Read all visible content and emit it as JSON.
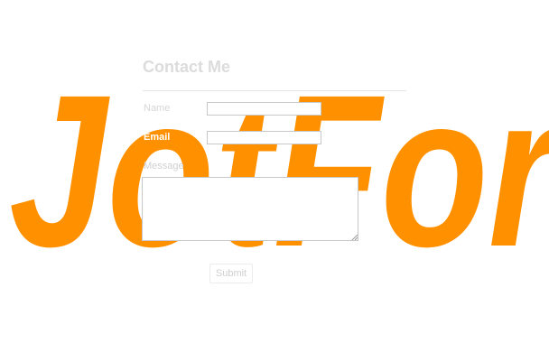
{
  "watermark": {
    "text": "JotForm",
    "color": "#ff9100"
  },
  "form": {
    "title": "Contact Me",
    "fields": {
      "name": {
        "label": "Name",
        "value": ""
      },
      "email": {
        "label": "Email",
        "value": ""
      },
      "message": {
        "label": "Message",
        "value": ""
      }
    },
    "submit_label": "Submit"
  },
  "icons": {
    "resize_handle": "textarea-resize-icon"
  }
}
